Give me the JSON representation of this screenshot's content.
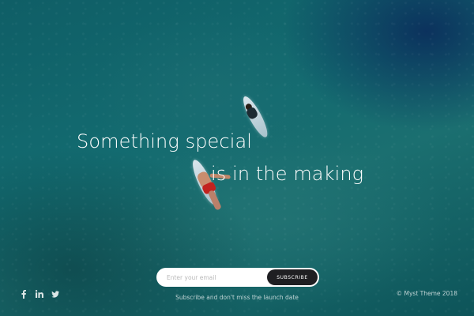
{
  "hero": {
    "headline_line1": "Something special",
    "headline_line2": "is in the making"
  },
  "subscribe": {
    "email_placeholder": "Enter your email",
    "email_value": "",
    "button_label": "SUBSCRIBE",
    "hint": "Subscribe and don't miss the launch date"
  },
  "social": [
    {
      "icon": "facebook-icon"
    },
    {
      "icon": "linkedin-icon"
    },
    {
      "icon": "twitter-icon"
    }
  ],
  "footer": {
    "copyright": "© Myst Theme 2018"
  },
  "colors": {
    "text": "#ffffff",
    "button_bg": "#1f1f22",
    "ocean": "#136b70"
  }
}
